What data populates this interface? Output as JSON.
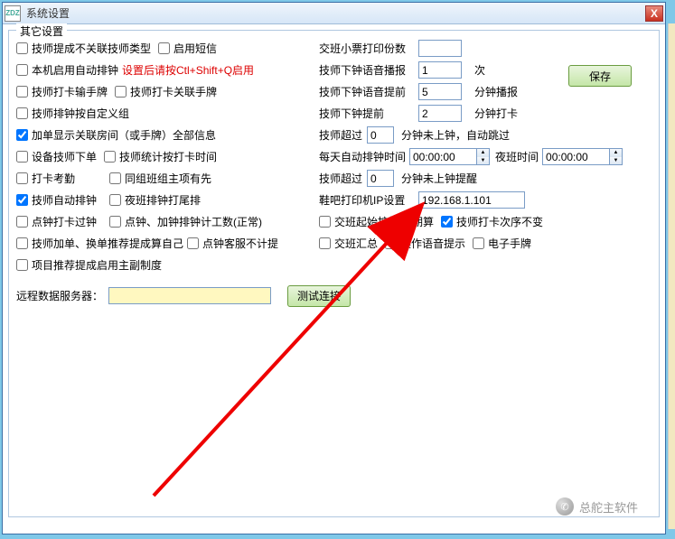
{
  "window": {
    "title": "系统设置",
    "close_icon": "X"
  },
  "fieldset": {
    "legend": "其它设置"
  },
  "left": {
    "r1a": "技师提成不关联技师类型",
    "r1b": "启用短信",
    "r2a": "本机启用自动排钟",
    "r2b": "设置后请按Ctl+Shift+Q启用",
    "r3a": "技师打卡输手牌",
    "r3b": "技师打卡关联手牌",
    "r4": "技师排钟按自定义组",
    "r5": "加单显示关联房间（或手牌）全部信息",
    "r6a": "设备技师下单",
    "r6b": "技师统计按打卡时间",
    "r7a": "打卡考勤",
    "r7b": "同组班组主项有先",
    "r8a": "技师自动排钟",
    "r8b": "夜班排钟打尾排",
    "r9a": "点钟打卡过钟",
    "r9b": "点钟、加钟排钟计工数(正常)",
    "r10a": "技师加单、换单推荐提成算自己",
    "r10b": "点钟客服不计提",
    "r11": "项目推荐提成启用主副制度"
  },
  "right": {
    "r1_label": "交班小票打印份数",
    "r1_val": "",
    "r2_label": "技师下钟语音播报",
    "r2_val": "1",
    "r2_unit": "次",
    "r3_label": "技师下钟语音提前",
    "r3_val": "5",
    "r3_unit": "分钟播报",
    "r4_label": "技师下钟提前",
    "r4_val": "2",
    "r4_unit": "分钟打卡",
    "r5_label": "技师超过",
    "r5_val": "0",
    "r5_unit": "分钟未上钟，自动跳过",
    "r6_label": "每天自动排钟时间",
    "r6_val": "00:00:00",
    "r6_label2": "夜班时间",
    "r6_val2": "00:00:00",
    "r7_label": "技师超过",
    "r7_val": "0",
    "r7_unit": "分钟未上钟提醒",
    "r8_label": "鞋吧打印机IP设置",
    "r8_val": "192.168.1.101",
    "r9a": "交班起始按签",
    "r9b": "日期算",
    "r9c": "技师打卡次序不变",
    "r10a": "交班汇总",
    "r10b": "操作语音提示",
    "r10c": "电子手牌"
  },
  "remote": {
    "label": "远程数据服务器：",
    "val": ""
  },
  "buttons": {
    "save": "保存",
    "test": "测试连接"
  },
  "watermark": {
    "text": "总舵主软件",
    "icon": "✆"
  }
}
